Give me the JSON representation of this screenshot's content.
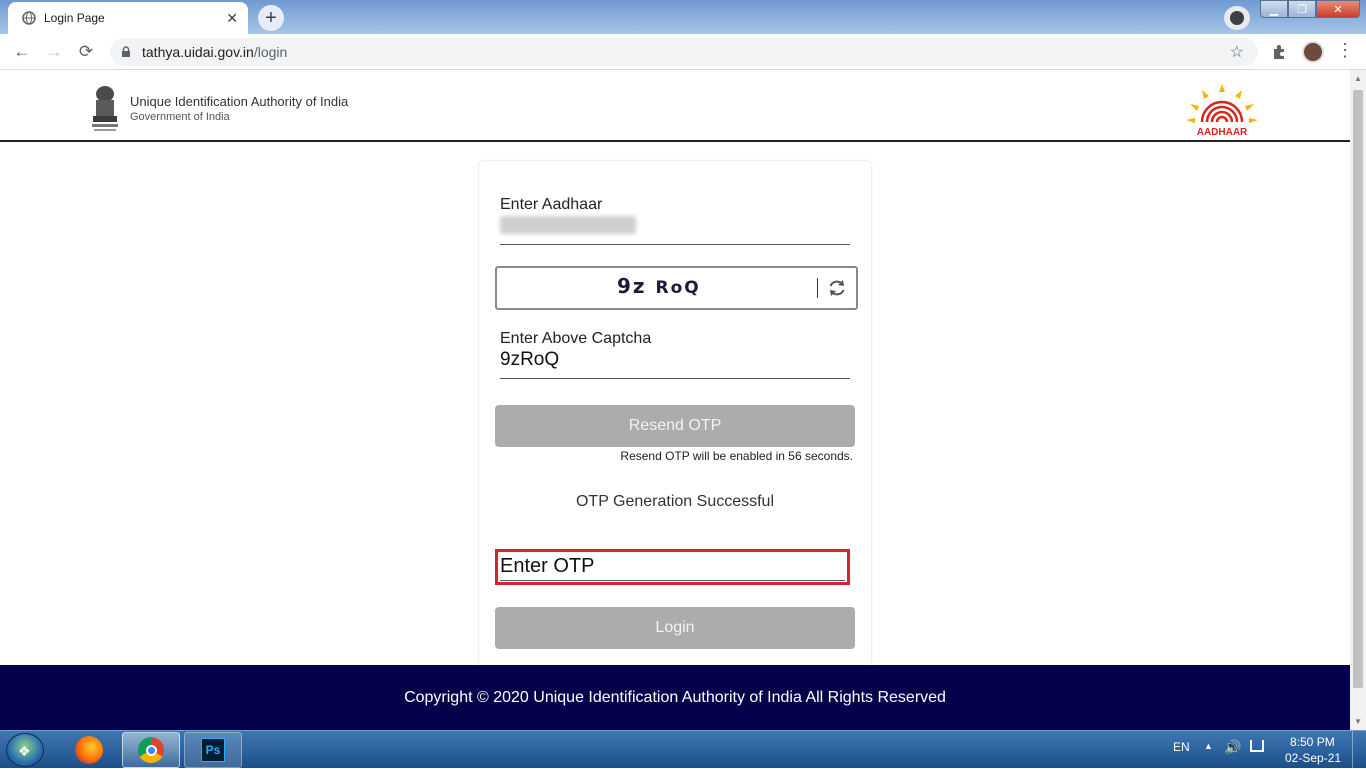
{
  "browser": {
    "tab_title": "Login Page",
    "tab_close": "✕",
    "new_tab": "+",
    "url_host": "tathya.uidai.gov.in",
    "url_path": "/login"
  },
  "header": {
    "org_name": "Unique Identification Authority of India",
    "org_sub": "Government of India",
    "logo_text": "AADHAAR"
  },
  "form": {
    "aadhaar_label": "Enter Aadhaar",
    "captcha_image_text": "9z",
    "captcha_image_text2": "RoQ",
    "captcha_label": "Enter Above Captcha",
    "captcha_value": "9zRoQ",
    "resend_button": "Resend OTP",
    "resend_note": "Resend OTP will be enabled in 56 seconds.",
    "otp_status": "OTP Generation Successful",
    "otp_placeholder": "Enter OTP",
    "login_button": "Login"
  },
  "footer": {
    "copyright": "Copyright © 2020 Unique Identification Authority of India All Rights Reserved"
  },
  "taskbar": {
    "ps_label": "Ps",
    "language": "EN",
    "time": "8:50 PM",
    "date": "02-Sep-21"
  },
  "colors": {
    "footer_bg": "#03024a",
    "button_disabled": "#acacac",
    "otp_highlight": "#d3242f"
  },
  "icons": [
    "globe-icon",
    "back-icon",
    "forward-icon",
    "reload-icon",
    "lock-icon",
    "star-icon",
    "extensions-icon",
    "refresh-icon",
    "emblem-icon",
    "aadhaar-logo-icon"
  ]
}
